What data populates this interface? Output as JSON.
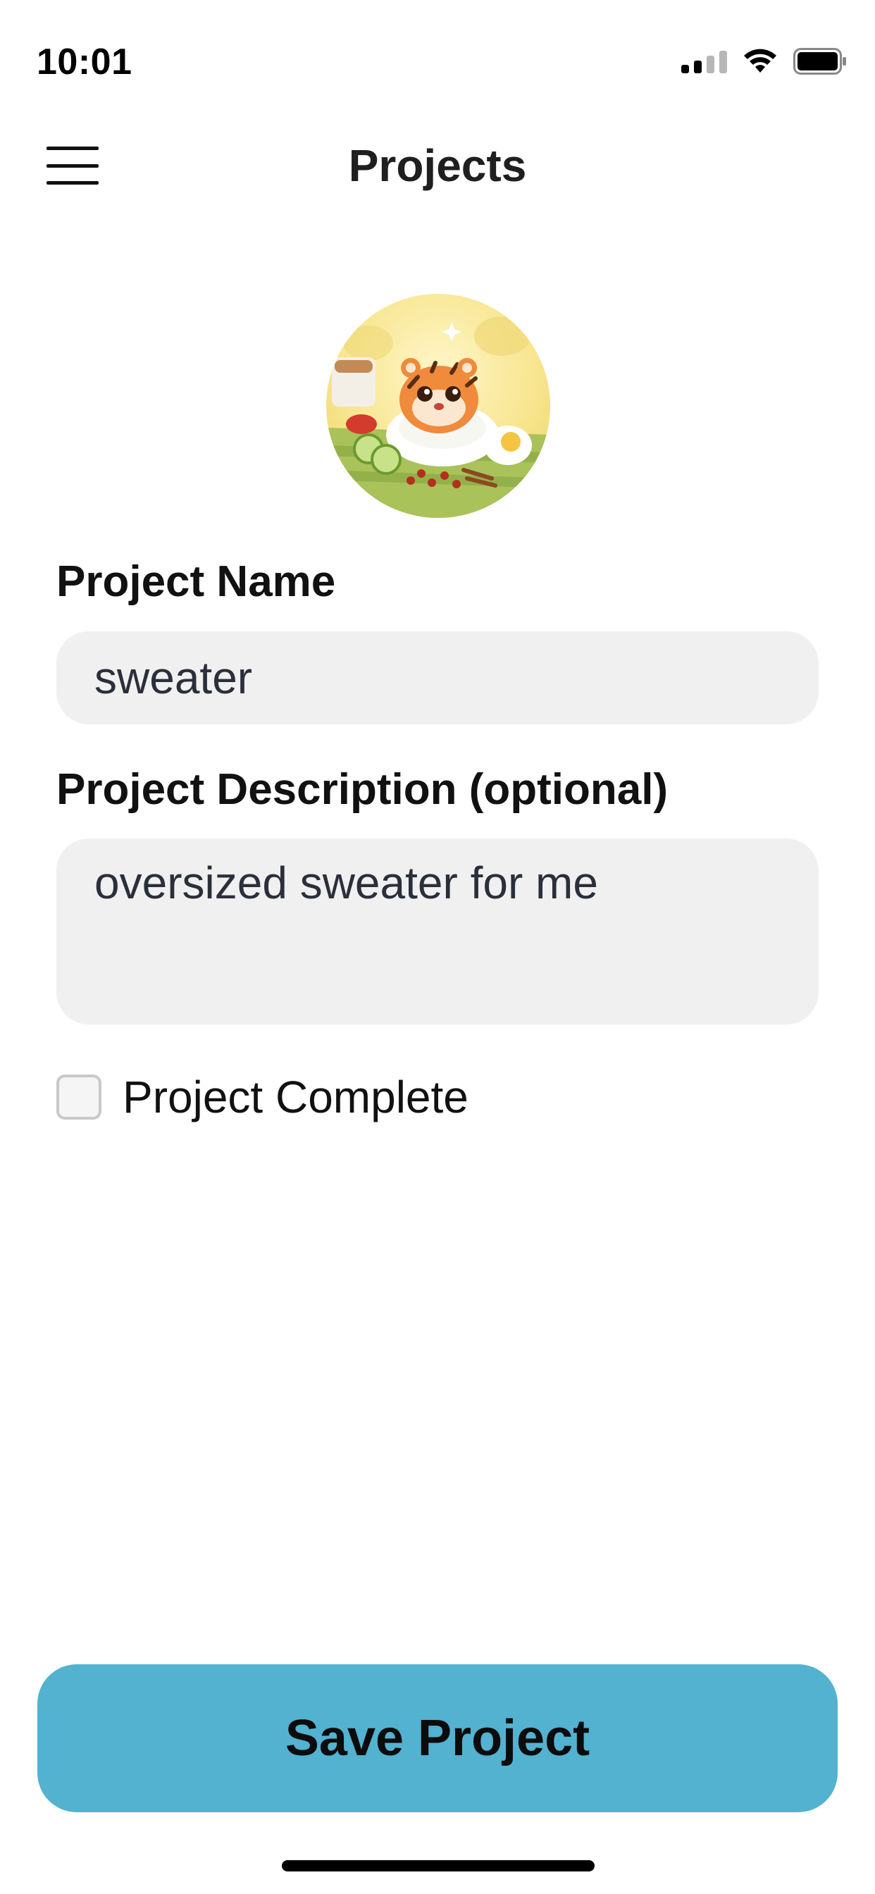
{
  "status_bar": {
    "time": "10:01",
    "icons": [
      "signal-icon",
      "wifi-icon",
      "battery-icon"
    ]
  },
  "nav": {
    "title": "Projects",
    "menu_icon": "hamburger-menu-icon"
  },
  "avatar": {
    "icon": "project-avatar-image"
  },
  "form": {
    "name_label": "Project Name",
    "name_value": "sweater",
    "description_label": "Project Description (optional)",
    "description_value": "oversized sweater for me",
    "complete_label": "Project Complete",
    "complete_checked": false
  },
  "actions": {
    "save_label": "Save Project"
  },
  "colors": {
    "accent": "#52b2d0",
    "field_bg": "#f0f0f0"
  }
}
